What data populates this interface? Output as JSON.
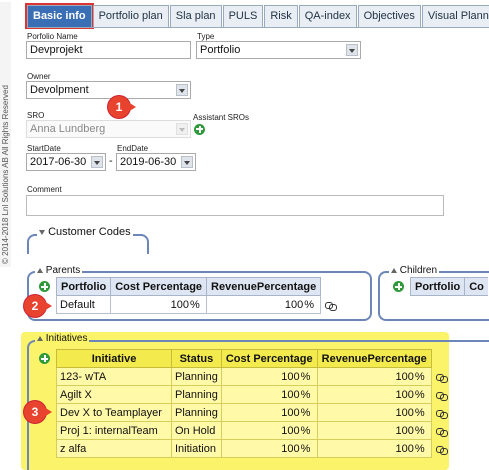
{
  "copyright": "© 2014-2018 Lnl Solutions AB All Rights Reserved",
  "tabs": [
    {
      "label": "Basic info",
      "active": true
    },
    {
      "label": "Portfolio plan"
    },
    {
      "label": "Sla plan"
    },
    {
      "label": "PULS"
    },
    {
      "label": "Risk"
    },
    {
      "label": "QA-index"
    },
    {
      "label": "Objectives"
    },
    {
      "label": "Visual Planning"
    }
  ],
  "form": {
    "portfolio_name_label": "Porfolio Name",
    "portfolio_name_value": "Devprojekt",
    "type_label": "Type",
    "type_value": "Portfolio",
    "owner_label": "Owner",
    "owner_value": "Devolpment",
    "sro_label": "SRO",
    "sro_value": "Anna Lundberg",
    "assistant_sros_label": "Assistant SROs",
    "start_date_label": "StartDate",
    "start_date_value": "2017-06-30",
    "end_date_label": "EndDate",
    "end_date_value": "2019-06-30",
    "date_separator": "-",
    "comment_label": "Comment",
    "comment_value": ""
  },
  "customer_codes": {
    "legend": "Customer Codes"
  },
  "parents": {
    "legend": "Parents",
    "columns": [
      "Portfolio",
      "Cost Percentage",
      "RevenuePercentage"
    ],
    "rows": [
      {
        "portfolio": "Default",
        "cost": "100",
        "revenue": "100"
      }
    ]
  },
  "children": {
    "legend": "Children",
    "columns": [
      "Portfolio",
      "Co"
    ]
  },
  "initiatives": {
    "legend": "Initiatives",
    "columns": [
      "Initiative",
      "Status",
      "Cost Percentage",
      "RevenuePercentage"
    ],
    "rows": [
      {
        "initiative": "123- wTA",
        "status": "Planning",
        "cost": "100",
        "revenue": "100"
      },
      {
        "initiative": "Agilt X",
        "status": "Planning",
        "cost": "100",
        "revenue": "100"
      },
      {
        "initiative": "Dev X to Teamplayer",
        "status": "Planning",
        "cost": "100",
        "revenue": "100"
      },
      {
        "initiative": "Proj 1: internalTeam",
        "status": "On Hold",
        "cost": "100",
        "revenue": "100"
      },
      {
        "initiative": "z alfa",
        "status": "Initiation",
        "cost": "100",
        "revenue": "100"
      }
    ]
  },
  "percent_symbol": "%",
  "callouts": [
    "1",
    "2",
    "3"
  ],
  "colors": {
    "accent": "#3a6fb6",
    "callout": "#e8432e",
    "highlight": "#fbf46a",
    "group_border": "#6d86b8"
  }
}
